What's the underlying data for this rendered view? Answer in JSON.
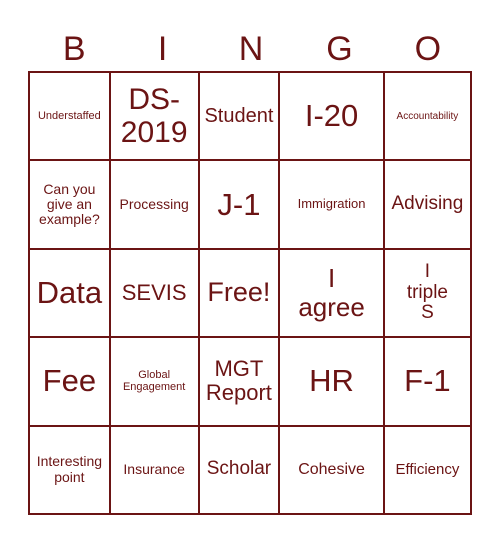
{
  "header": {
    "letters": [
      "B",
      "I",
      "N",
      "G",
      "O"
    ]
  },
  "theme": {
    "accent": "#6b1414",
    "background": "#ffffff"
  },
  "cells": [
    [
      "Understaffed",
      "DS-2019",
      "Student",
      "I-20",
      "Accountability"
    ],
    [
      "Can you give an example?",
      "Processing",
      "J-1",
      "Immigration",
      "Advising"
    ],
    [
      "Data",
      "SEVIS",
      "Free!",
      "I agree",
      "I triple S"
    ],
    [
      "Fee",
      "Global Engagement",
      "MGT Report",
      "HR",
      "F-1"
    ],
    [
      "Interesting point",
      "Insurance",
      "Scholar",
      "Cohesive",
      "Efficiency"
    ]
  ]
}
